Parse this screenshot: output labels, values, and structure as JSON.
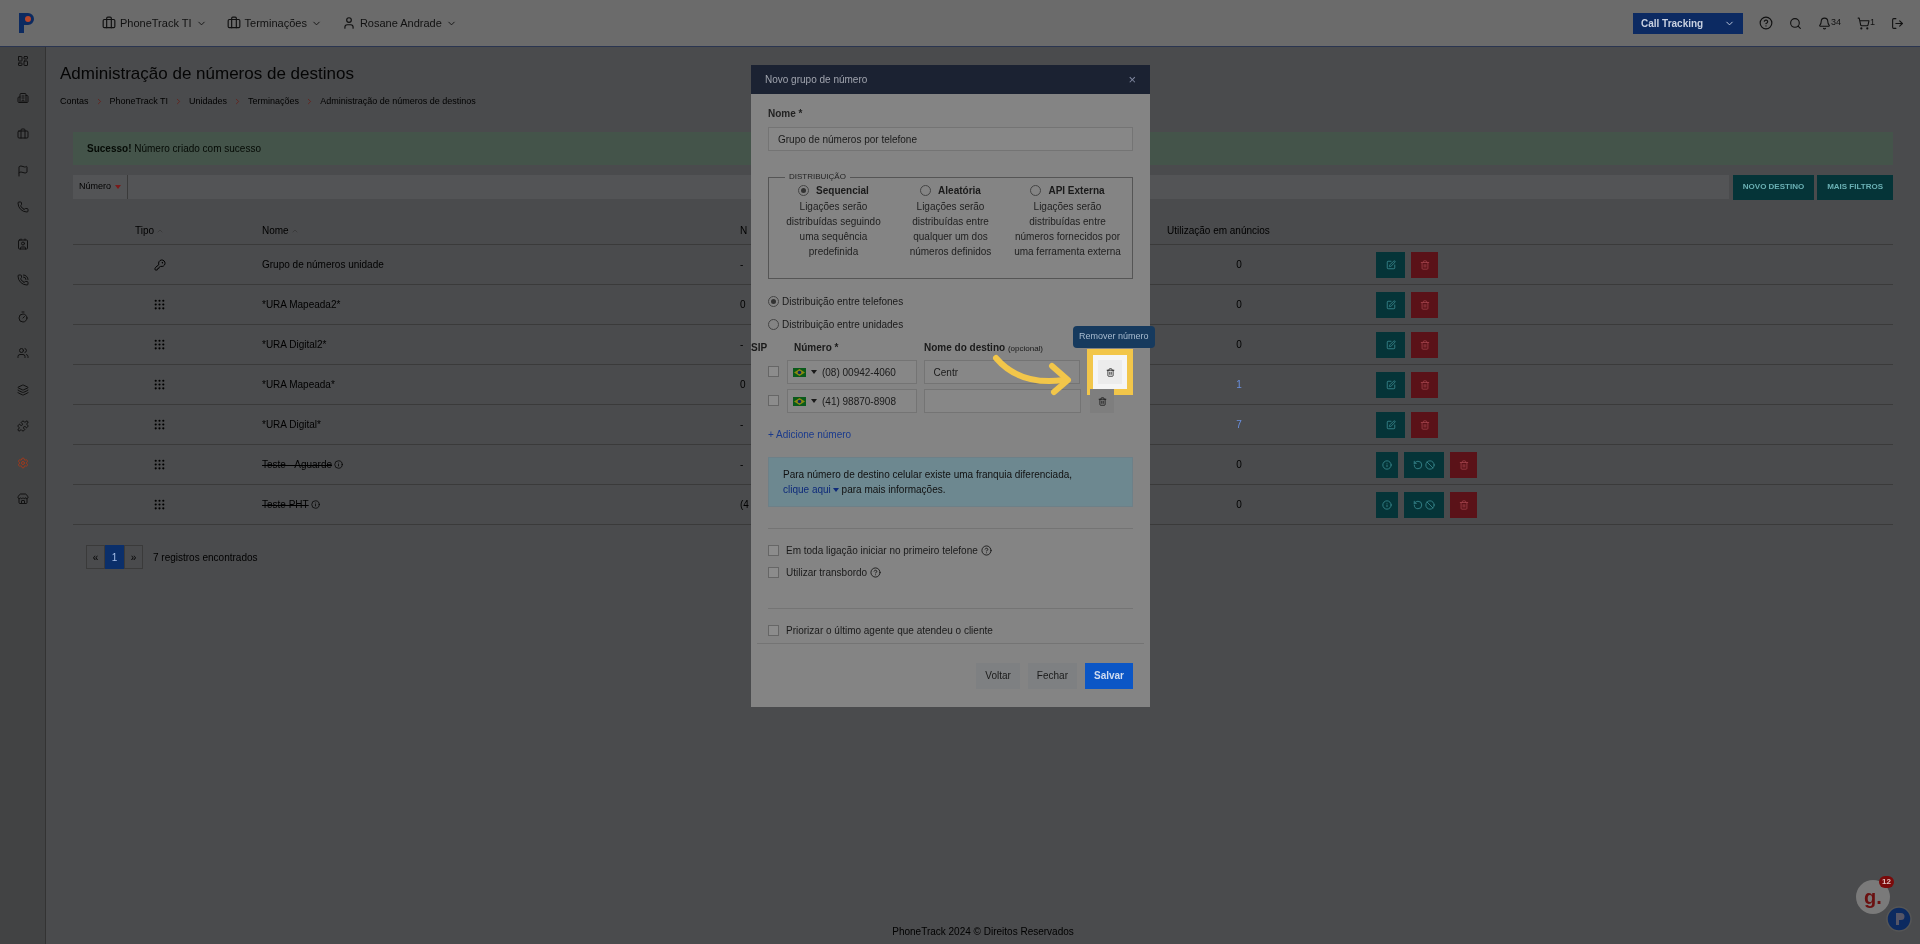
{
  "header": {
    "menus": [
      {
        "label": "PhoneTrack TI",
        "kind": "company"
      },
      {
        "label": "Terminações",
        "kind": "company"
      },
      {
        "label": "Rosane Andrade",
        "kind": "user"
      }
    ],
    "product": "Call Tracking",
    "notifications": "34",
    "cart": "1"
  },
  "sidebar": {
    "items": [
      {
        "selected": false
      },
      {
        "selected": false
      },
      {
        "selected": false
      },
      {
        "selected": false
      },
      {
        "selected": false
      },
      {
        "selected": false
      },
      {
        "selected": false
      },
      {
        "selected": false
      },
      {
        "selected": false
      },
      {
        "selected": false
      },
      {
        "selected": false
      },
      {
        "selected": true
      },
      {
        "selected": false
      }
    ]
  },
  "page": {
    "title": "Administração de números de destinos",
    "breadcrumb": [
      "Contas",
      "PhoneTrack TI",
      "Unidades",
      "Terminações",
      "Administração de números de destinos"
    ],
    "alert": {
      "strong": "Sucesso!",
      "text": "Número criado com sucesso"
    },
    "filter": {
      "label": "Número"
    },
    "buttons": [
      "NOVO DESTINO",
      "MAIS FILTROS"
    ],
    "table": {
      "columns": [
        {
          "label": "Tipo",
          "sortable": true
        },
        {
          "label": "Nome",
          "sortable": true
        },
        {
          "label": "N",
          "sortable": false
        },
        {
          "label": "Utilização em anúncios",
          "sortable": false
        }
      ],
      "rows": [
        {
          "kind": "group",
          "name": "Grupo de números unidade",
          "disabled": false,
          "column_3": "-",
          "usage": "0",
          "usage_link": false,
          "actions": [
            {
              "kind": "edit"
            },
            {
              "kind": "delete"
            }
          ]
        },
        {
          "kind": "ura",
          "name": "*URA Mapeada2*",
          "disabled": false,
          "column_3": "0",
          "usage": "0",
          "usage_link": false,
          "actions": [
            {
              "kind": "edit"
            },
            {
              "kind": "delete"
            }
          ]
        },
        {
          "kind": "ura",
          "name": "*URA Digital2*",
          "disabled": false,
          "column_3": "-",
          "usage": "0",
          "usage_link": false,
          "actions": [
            {
              "kind": "edit"
            },
            {
              "kind": "delete"
            }
          ]
        },
        {
          "kind": "ura",
          "name": "*URA Mapeada*",
          "disabled": false,
          "column_3": "0",
          "usage": "1",
          "usage_link": true,
          "actions": [
            {
              "kind": "edit"
            },
            {
              "kind": "delete"
            }
          ]
        },
        {
          "kind": "ura",
          "name": "*URA Digital*",
          "disabled": false,
          "column_3": "-",
          "usage": "7",
          "usage_link": true,
          "actions": [
            {
              "kind": "edit"
            },
            {
              "kind": "delete"
            }
          ]
        },
        {
          "kind": "ura",
          "name": "Teste - Aguarde",
          "disabled": true,
          "column_3": "-",
          "usage": "0",
          "usage_link": false,
          "actions": [
            {
              "kind": "info"
            },
            {
              "kind": "restore"
            },
            {
              "kind": "delete"
            }
          ]
        },
        {
          "kind": "ura",
          "name": "Teste PHT",
          "disabled": true,
          "column_3": "(4",
          "usage": "0",
          "usage_link": false,
          "actions": [
            {
              "kind": "info"
            },
            {
              "kind": "restore"
            },
            {
              "kind": "delete"
            }
          ]
        }
      ]
    },
    "pagination": {
      "pages": [
        {
          "label": "1",
          "selected": true
        }
      ],
      "prev": "«",
      "next": "»",
      "count": "7 registros encontrados"
    },
    "footer": "PhoneTrack 2024 © Direitos Reservados"
  },
  "modal": {
    "title": "Novo grupo de número",
    "close": "×",
    "name_label": "Nome *",
    "name_value": "Grupo de números por telefone",
    "legend": "DISTRIBUIÇÃO",
    "options": [
      {
        "title": "Sequencial",
        "desc": "Ligações serão distribuídas seguindo uma sequência predefinida",
        "selected": true
      },
      {
        "title": "Aleatória",
        "desc": "Ligações serão distribuídas entre qualquer um dos números definidos",
        "selected": false
      },
      {
        "title": "API Externa",
        "desc": "Ligações serão distribuídas entre números fornecidos por uma ferramenta externa",
        "selected": false
      }
    ],
    "modes": [
      {
        "label": "Distribuição entre telefones",
        "selected": true
      },
      {
        "label": "Distribuição entre unidades",
        "selected": false
      }
    ],
    "cols": {
      "sip": "SIP",
      "number": "Número *",
      "dest": "Nome do destino",
      "optional": "(opcional)"
    },
    "numbers": [
      {
        "sip": false,
        "number": "(08) 00942-4060",
        "dest": "Centr",
        "highlighted": true
      },
      {
        "sip": false,
        "number": "(41) 98870-8908",
        "highlighted": false
      }
    ],
    "tooltip": "Remover número",
    "add": "+ Adicione número",
    "info": "Para número de destino celular existe uma franquia diferenciada,",
    "info_link": "clique aqui",
    "info_rest": "para mais informações.",
    "checks": [
      {
        "label": "Em toda ligação iniciar no primeiro telefone",
        "checked": false,
        "help": true
      },
      {
        "label": "Utilizar transbordo",
        "checked": false,
        "help": true
      },
      {
        "label": "Priorizar o último agente que atendeu o cliente",
        "checked": false,
        "help": false
      }
    ],
    "buttons": [
      {
        "label": "Voltar",
        "kind": "secondary"
      },
      {
        "label": "Fechar",
        "kind": "secondary"
      },
      {
        "label": "Salvar",
        "kind": "primary"
      }
    ]
  },
  "widget": {
    "letter": "g.",
    "badge": "12"
  }
}
